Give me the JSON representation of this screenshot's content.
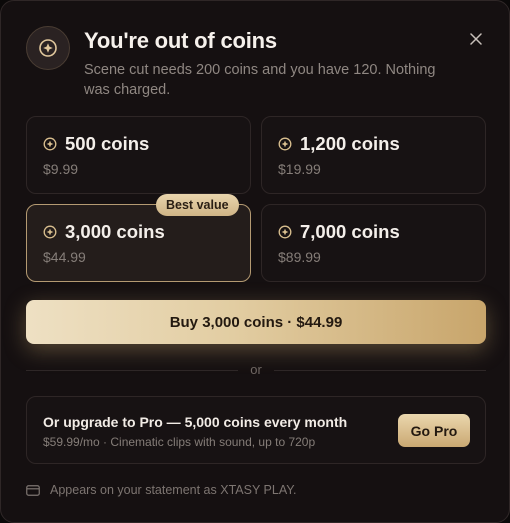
{
  "header": {
    "icon": "coin-icon",
    "title": "You're out of coins",
    "subtitle": "Scene cut needs 200 coins and you have 120. Nothing was charged.",
    "close_icon": "close-icon"
  },
  "packs": [
    {
      "coins": "500 coins",
      "price": "$9.99",
      "selected": false
    },
    {
      "coins": "1,200 coins",
      "price": "$19.99",
      "selected": false
    },
    {
      "coins": "3,000 coins",
      "price": "$44.99",
      "selected": true,
      "badge": "Best value"
    },
    {
      "coins": "7,000 coins",
      "price": "$89.99",
      "selected": false
    }
  ],
  "buy_button": {
    "label": "Buy 3,000 coins · $44.99"
  },
  "divider": {
    "label": "or"
  },
  "pro": {
    "title": "Or upgrade to Pro — 5,000 coins every month",
    "subtitle": "$59.99/mo · Cinematic clips with sound, up to 720p",
    "button_label": "Go Pro"
  },
  "footer": {
    "icon": "card-icon",
    "text": "Appears on your statement as XTASY PLAY."
  },
  "colors": {
    "accent_gold": "#d9bf8f",
    "background": "#151011",
    "selected_border": "#b49a72"
  }
}
